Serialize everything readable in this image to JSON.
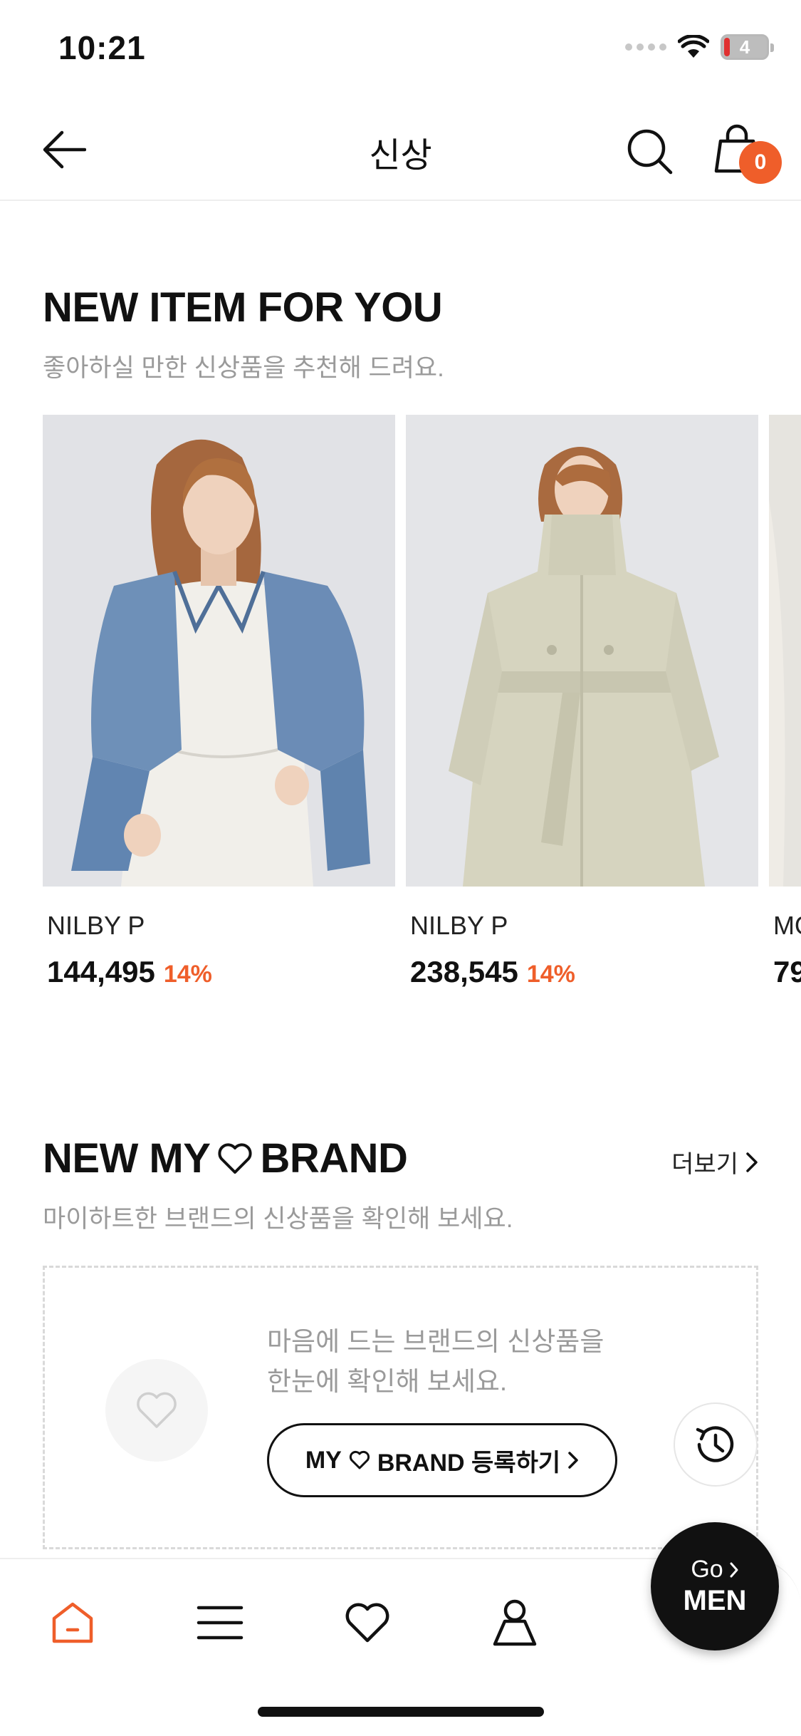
{
  "status_bar": {
    "time": "10:21",
    "battery": "4"
  },
  "header": {
    "title": "신상",
    "cart_count": "0"
  },
  "new_items": {
    "title": "NEW ITEM FOR YOU",
    "subtitle": "좋아하실 만한 신상품을 추천해 드려요.",
    "products": [
      {
        "brand": "NILBY P",
        "price": "144,495",
        "discount": "14%"
      },
      {
        "brand": "NILBY P",
        "price": "238,545",
        "discount": "14%"
      },
      {
        "brand": "MO",
        "price": "79",
        "discount": ""
      }
    ]
  },
  "my_brand": {
    "title_prefix": "NEW MY",
    "title_suffix": "BRAND",
    "more_label": "더보기",
    "subtitle": "마이하트한 브랜드의 신상품을 확인해 보세요.",
    "empty_line1": "마음에 드는 브랜드의 신상품을",
    "empty_line2": "한눈에 확인해 보세요.",
    "register_prefix": "MY",
    "register_suffix": "BRAND 등록하기"
  },
  "go_men": {
    "go": "Go",
    "men": "MEN"
  },
  "colors": {
    "accent": "#ef5e2a",
    "text": "#111111",
    "muted": "#9a9a9a"
  },
  "icons": [
    "back-arrow-icon",
    "search-icon",
    "shopping-bag-icon",
    "heart-icon",
    "history-icon",
    "home-icon",
    "menu-icon",
    "person-icon",
    "chevron-right-icon"
  ]
}
